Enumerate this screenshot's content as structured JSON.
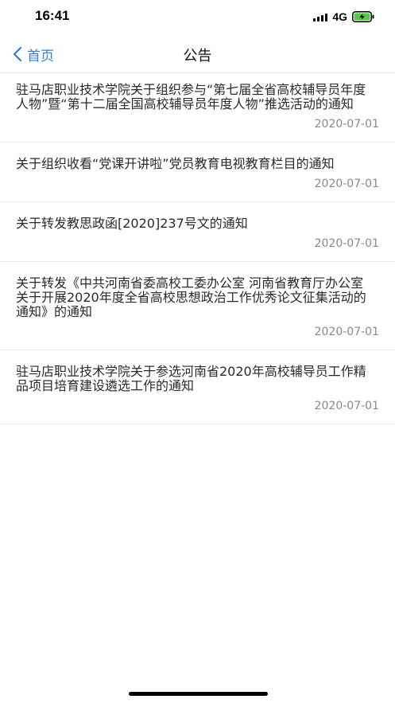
{
  "status_bar": {
    "time": "16:41",
    "network": "4G",
    "battery_color": "#5ac84a"
  },
  "nav": {
    "back_label": "首页",
    "title": "公告",
    "accent": "#2f7ce6"
  },
  "notices": [
    {
      "title": "驻马店职业技术学院关于组织参与“第七届全省高校辅导员年度人物”暨“第十二届全国高校辅导员年度人物”推选活动的通知",
      "date": "2020-07-01"
    },
    {
      "title": "关于组织收看“党课开讲啦”党员教育电视教育栏目的通知",
      "date": "2020-07-01"
    },
    {
      "title": "关于转发教思政函[2020]237号文的通知",
      "date": "2020-07-01"
    },
    {
      "title": "关于转发《中共河南省委高校工委办公室 河南省教育厅办公室关于开展2020年度全省高校思想政治工作优秀论文征集活动的通知》的通知",
      "date": "2020-07-01"
    },
    {
      "title": "驻马店职业技术学院关于参选河南省2020年高校辅导员工作精品项目培育建设遴选工作的通知",
      "date": "2020-07-01"
    }
  ]
}
